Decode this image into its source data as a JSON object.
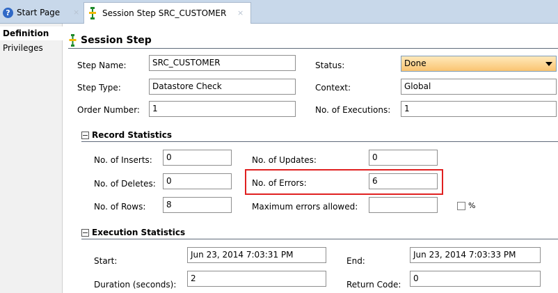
{
  "tabs": [
    {
      "label": "Start Page"
    },
    {
      "label": "Session Step SRC_CUSTOMER"
    }
  ],
  "close_glyph": "×",
  "nav": {
    "items": [
      "Definition",
      "Privileges"
    ]
  },
  "section": {
    "title": "Session Step"
  },
  "step": {
    "name": {
      "label": "Step Name:",
      "value": "SRC_CUSTOMER"
    },
    "type": {
      "label": "Step Type:",
      "value": "Datastore Check"
    },
    "order": {
      "label": "Order Number:",
      "value": "1"
    },
    "status": {
      "label": "Status:",
      "value": "Done"
    },
    "context": {
      "label": "Context:",
      "value": "Global"
    },
    "executions": {
      "label": "No. of Executions:",
      "value": "1"
    }
  },
  "record_stats": {
    "title": "Record Statistics",
    "inserts": {
      "label": "No. of Inserts:",
      "value": "0"
    },
    "deletes": {
      "label": "No. of Deletes:",
      "value": "0"
    },
    "rows": {
      "label": "No. of Rows:",
      "value": "8"
    },
    "updates": {
      "label": "No. of Updates:",
      "value": "0"
    },
    "errors": {
      "label": "No. of Errors:",
      "value": "6"
    },
    "max_errors": {
      "label": "Maximum errors allowed:",
      "value": ""
    },
    "percent_label": "%"
  },
  "exec_stats": {
    "title": "Execution Statistics",
    "start": {
      "label": "Start:",
      "value": "Jun 23, 2014 7:03:31 PM"
    },
    "duration": {
      "label": "Duration (seconds):",
      "value": "2"
    },
    "end": {
      "label": "End:",
      "value": "Jun 23, 2014 7:03:33 PM"
    },
    "return_code": {
      "label": "Return Code:",
      "value": "0"
    }
  },
  "colors": {
    "highlight": "#e02020",
    "status_fill": "#fac471",
    "tabbar": "#c8d8ea"
  },
  "icons": [
    "help-icon",
    "session-step-icon",
    "collapse-icon",
    "chevron-down-icon"
  ]
}
